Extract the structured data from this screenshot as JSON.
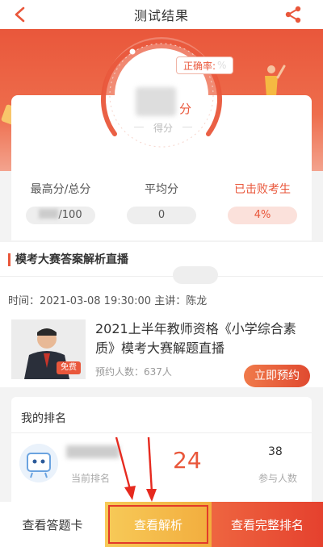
{
  "header": {
    "title": "测试结果",
    "back_icon": "chevron-left-icon",
    "share_icon": "share-icon"
  },
  "score": {
    "accuracy_label": "正确率:",
    "accuracy_value": "%",
    "unit": "分",
    "label": "得分"
  },
  "stats": {
    "highest": {
      "label": "最高分/总分",
      "value": "/100"
    },
    "average": {
      "label": "平均分",
      "value": "0"
    },
    "beaten": {
      "label": "已击败考生",
      "value": "4%"
    }
  },
  "live": {
    "title": "模考大赛答案解析直播",
    "meta": "时间：2021-03-08 19:30:00   主讲：陈龙",
    "course_title": "2021上半年教师资格《小学综合素质》模考大赛解题直播",
    "booking": "预约人数：637人",
    "free_badge": "免费",
    "book_button": "立即预约"
  },
  "ranking": {
    "title": "我的排名",
    "current_label": "当前排名",
    "rank": "24",
    "participants": "38",
    "participants_label": "参与人数"
  },
  "bottom": {
    "answer_card": "查看答题卡",
    "analysis": "查看解析",
    "full_ranking": "查看完整排名"
  },
  "colors": {
    "accent": "#e9573b",
    "highlight_border": "#e23a2a",
    "gold": "#f2ad3e"
  }
}
